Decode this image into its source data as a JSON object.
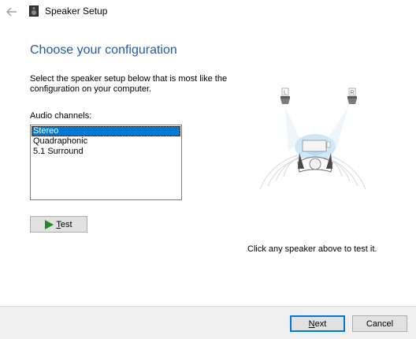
{
  "window": {
    "title": "Speaker Setup",
    "back_icon": "back-arrow-icon",
    "app_icon": "speaker-icon"
  },
  "main": {
    "heading": "Choose your configuration",
    "instructions": "Select the speaker setup below that is most like the configuration on your computer.",
    "channels_label": "Audio channels:",
    "channels": [
      {
        "label": "Stereo",
        "selected": true
      },
      {
        "label": "Quadraphonic",
        "selected": false
      },
      {
        "label": "5.1 Surround",
        "selected": false
      }
    ],
    "test_button": "Test",
    "diagram": {
      "left_label": "L",
      "right_label": "R"
    },
    "hint": "Click any speaker above to test it."
  },
  "footer": {
    "next_label": "Next",
    "cancel_label": "Cancel"
  },
  "colors": {
    "heading": "#1f5ca8",
    "selection": "#0078d7",
    "test_icon": "#1e8a2a",
    "footer_bg": "#f0f0f0"
  }
}
